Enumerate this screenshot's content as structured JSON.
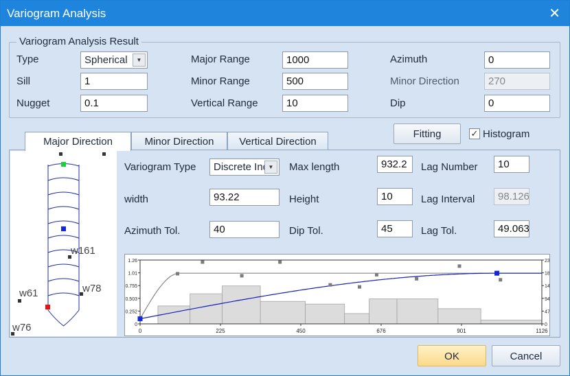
{
  "window": {
    "title": "Variogram Analysis"
  },
  "result": {
    "legend": "Variogram Analysis Result",
    "type_label": "Type",
    "type_value": "Spherical",
    "sill_label": "Sill",
    "sill_value": "1",
    "nugget_label": "Nugget",
    "nugget_value": "0.1",
    "major_range_label": "Major Range",
    "major_range_value": "1000",
    "minor_range_label": "Minor Range",
    "minor_range_value": "500",
    "vertical_range_label": "Vertical Range",
    "vertical_range_value": "10",
    "azimuth_label": "Azimuth",
    "azimuth_value": "0",
    "minor_direction_label": "Minor Direction",
    "minor_direction_value": "270",
    "dip_label": "Dip",
    "dip_value": "0"
  },
  "fitting_button": "Fitting",
  "histogram": {
    "label": "Histogram",
    "checked": true,
    "check_glyph": "✓"
  },
  "tabs": [
    "Major Direction",
    "Minor Direction",
    "Vertical Direction"
  ],
  "params": {
    "variogram_type_label": "Variogram Type",
    "variogram_type_value": "Discrete Ind",
    "width_label": "width",
    "width_value": "93.22",
    "azimuth_tol_label": "Azimuth Tol.",
    "azimuth_tol_value": "40",
    "max_length_label": "Max length",
    "max_length_value": "932.2",
    "height_label": "Height",
    "height_value": "10",
    "dip_tol_label": "Dip Tol.",
    "dip_tol_value": "45",
    "lag_number_label": "Lag Number",
    "lag_number_value": "10",
    "lag_interval_label": "Lag Interval",
    "lag_interval_value": "98.126",
    "lag_tol_label": "Lag Tol.",
    "lag_tol_value": "49.063"
  },
  "wells": [
    "w161",
    "w78",
    "w61",
    "w76"
  ],
  "chart_data": {
    "type": "bar",
    "x_ticks": [
      "0",
      "225",
      "450",
      "676",
      "901",
      "1126"
    ],
    "x_range": [
      0,
      1126
    ],
    "y_left_ticks": [
      "0",
      "0.252",
      "0.503",
      "0.755",
      "1.01",
      "1.26"
    ],
    "y_left_range": [
      0,
      1.26
    ],
    "y_right_ticks": [
      "0",
      "471",
      "942",
      "1412",
      "1883",
      "2354"
    ],
    "y_right_range": [
      0,
      2354
    ],
    "histogram_bars": [
      {
        "x0": 50,
        "x1": 140,
        "v": 660
      },
      {
        "x0": 140,
        "x1": 230,
        "v": 1110
      },
      {
        "x0": 230,
        "x1": 337,
        "v": 1400
      },
      {
        "x0": 337,
        "x1": 463,
        "v": 830
      },
      {
        "x0": 463,
        "x1": 573,
        "v": 730
      },
      {
        "x0": 573,
        "x1": 642,
        "v": 380
      },
      {
        "x0": 642,
        "x1": 720,
        "v": 920
      },
      {
        "x0": 720,
        "x1": 835,
        "v": 920
      },
      {
        "x0": 835,
        "x1": 955,
        "v": 560
      },
      {
        "x0": 955,
        "x1": 1126,
        "v": 140
      }
    ],
    "experimental_points": [
      {
        "x": 105,
        "y": 0.99
      },
      {
        "x": 175,
        "y": 1.22
      },
      {
        "x": 285,
        "y": 0.95
      },
      {
        "x": 392,
        "y": 1.22
      },
      {
        "x": 533,
        "y": 0.77
      },
      {
        "x": 615,
        "y": 0.73
      },
      {
        "x": 663,
        "y": 0.97
      },
      {
        "x": 775,
        "y": 0.89
      },
      {
        "x": 895,
        "y": 1.14
      },
      {
        "x": 1010,
        "y": 0.87
      }
    ],
    "model_fit_major": {
      "nugget": 0.1,
      "sill": 1,
      "range": 1000
    },
    "model_reference": {
      "nugget": 0.1,
      "sill": 1,
      "range": 110
    },
    "control_points": [
      {
        "x": 0,
        "y": 0.1
      },
      {
        "x": 1000,
        "y": 1.0
      }
    ]
  },
  "dialog_buttons": {
    "ok": "OK",
    "cancel": "Cancel"
  }
}
